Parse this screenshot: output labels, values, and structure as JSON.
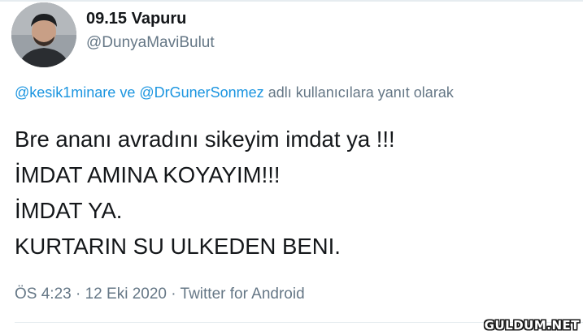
{
  "tweet": {
    "author": {
      "display_name": "09.15 Vapuru",
      "handle": "@DunyaMaviBulut"
    },
    "reply_context": {
      "mention_1": "@kesik1minare",
      "connector": "ve",
      "mention_2": "@DrGunerSonmez",
      "suffix": "adlı kullanıcılara yanıt olarak"
    },
    "text_lines": [
      "Bre ananı avradını sikeyim imdat ya !!!",
      "İMDAT AMINA KOYAYIM!!!",
      "İMDAT YA.",
      "KURTARIN SU ULKEDEN BENI."
    ],
    "meta": {
      "time": "ÖS 4:23",
      "date": "12 Eki 2020",
      "source": "Twitter for Android",
      "separator": "·"
    }
  },
  "watermark": {
    "text": "GULDUM.NET"
  },
  "colors": {
    "text_primary": "#14171a",
    "text_secondary": "#657786",
    "link": "#1b95e0",
    "border": "#e6ecf0"
  }
}
